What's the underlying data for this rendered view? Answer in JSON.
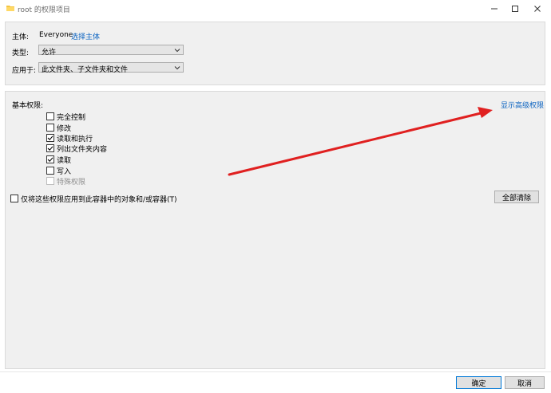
{
  "window": {
    "title": "root 的权限项目",
    "minimize_icon": "minimize-icon",
    "maximize_icon": "maximize-icon",
    "close_icon": "close-icon",
    "folder_icon": "folder-icon"
  },
  "principal": {
    "label": "主体:",
    "value": "Everyone",
    "select_link": "选择主体"
  },
  "type": {
    "label": "类型:",
    "selected": "允许"
  },
  "applies_to": {
    "label": "应用于:",
    "selected": "此文件夹、子文件夹和文件"
  },
  "permissions": {
    "heading": "基本权限:",
    "advanced_link": "显示高级权限",
    "items": [
      {
        "label": "完全控制",
        "checked": false,
        "disabled": false
      },
      {
        "label": "修改",
        "checked": false,
        "disabled": false
      },
      {
        "label": "读取和执行",
        "checked": true,
        "disabled": false
      },
      {
        "label": "列出文件夹内容",
        "checked": true,
        "disabled": false
      },
      {
        "label": "读取",
        "checked": true,
        "disabled": false
      },
      {
        "label": "写入",
        "checked": false,
        "disabled": false
      },
      {
        "label": "特殊权限",
        "checked": false,
        "disabled": true
      }
    ],
    "apply_within": {
      "label": "仅将这些权限应用到此容器中的对象和/或容器(T)",
      "checked": false
    },
    "clear_all": "全部清除"
  },
  "footer": {
    "ok": "确定",
    "cancel": "取消"
  },
  "colors": {
    "link": "#0b63c1",
    "annotation_arrow": "#e02020",
    "panel_bg": "#f0f0f0",
    "primary_border": "#0078d7"
  }
}
